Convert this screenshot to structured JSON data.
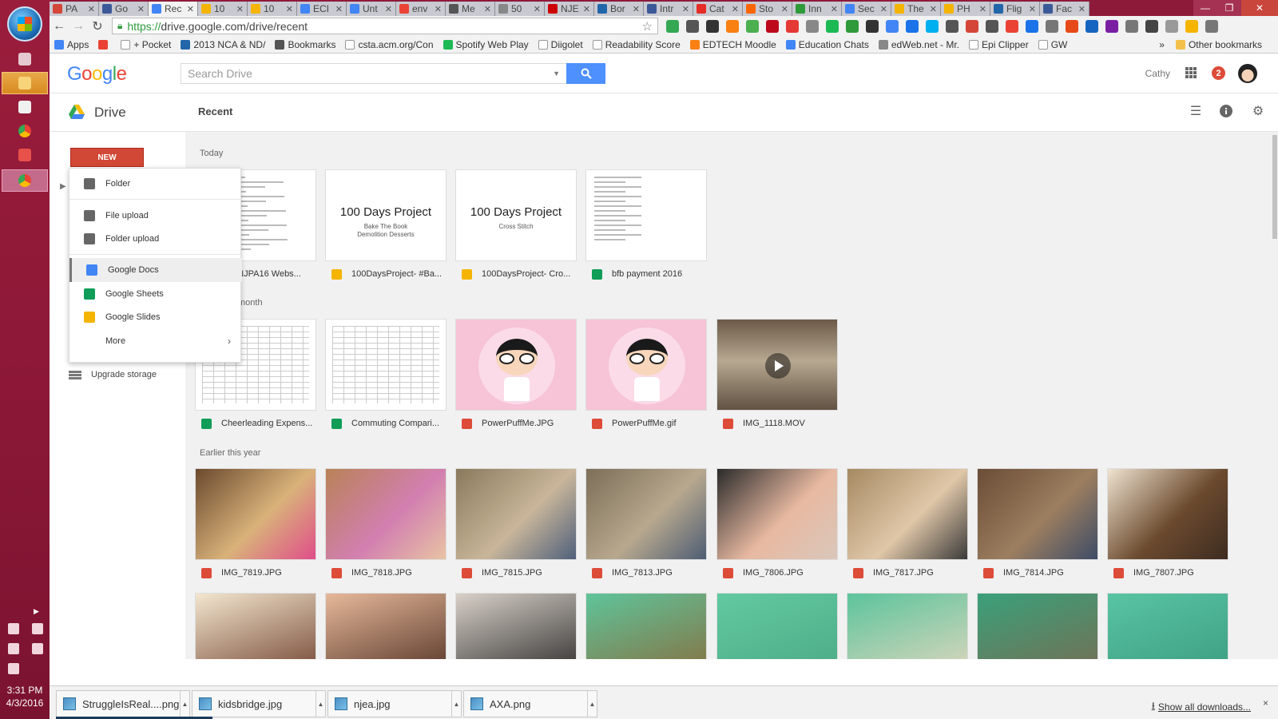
{
  "browser": {
    "tabs": [
      {
        "label": "PA",
        "color": "#d44638"
      },
      {
        "label": "Go",
        "color": "#3b5998"
      },
      {
        "label": "Rec",
        "color": "#4285f4",
        "active": true
      },
      {
        "label": "10",
        "color": "#f4b400"
      },
      {
        "label": "10",
        "color": "#f4b400"
      },
      {
        "label": "ECI",
        "color": "#4285f4"
      },
      {
        "label": "Unt",
        "color": "#4285f4"
      },
      {
        "label": "env",
        "color": "#ea4335"
      },
      {
        "label": "Me",
        "color": "#555555"
      },
      {
        "label": "50",
        "color": "#888888"
      },
      {
        "label": "NJE",
        "color": "#cc0000"
      },
      {
        "label": "Bor",
        "color": "#2266aa"
      },
      {
        "label": "Intr",
        "color": "#3b5998"
      },
      {
        "label": "Cat",
        "color": "#e52d27"
      },
      {
        "label": "Sto",
        "color": "#ff6600"
      },
      {
        "label": "Inn",
        "color": "#2e9a3a"
      },
      {
        "label": "Sec",
        "color": "#4285f4"
      },
      {
        "label": "The",
        "color": "#f4b400"
      },
      {
        "label": "PH",
        "color": "#f4b400"
      },
      {
        "label": "Flig",
        "color": "#2266aa"
      },
      {
        "label": "Fac",
        "color": "#3b5998"
      }
    ],
    "url_scheme": "https://",
    "url_rest": "drive.google.com/drive/recent",
    "bookmarks": [
      {
        "label": "Apps",
        "color": "#4285f4"
      },
      {
        "label": "",
        "color": "#ea4335"
      },
      {
        "label": "+ Pocket",
        "color": "#ffffff"
      },
      {
        "label": "2013 NCA & ND/",
        "color": "#2266aa"
      },
      {
        "label": "Bookmarks",
        "color": "#555555"
      },
      {
        "label": "csta.acm.org/Con",
        "color": "#ffffff"
      },
      {
        "label": "Spotify Web Play",
        "color": "#1db954"
      },
      {
        "label": "Diigolet",
        "color": "#ffffff"
      },
      {
        "label": "Readability Score",
        "color": "#ffffff"
      },
      {
        "label": "EDTECH Moodle",
        "color": "#f98012"
      },
      {
        "label": "Education Chats",
        "color": "#4285f4"
      },
      {
        "label": "edWeb.net - Mr.",
        "color": "#888888"
      },
      {
        "label": "Epi Clipper",
        "color": "#ffffff"
      },
      {
        "label": "GW",
        "color": "#ffffff"
      }
    ],
    "bookmarks_overflow": "»",
    "other_bookmarks": "Other bookmarks"
  },
  "header": {
    "logo": {
      "G": "G",
      "o1": "o",
      "o2": "o",
      "g": "g",
      "l": "l",
      "e": "e"
    },
    "search_placeholder": "Search Drive",
    "user_name": "Cathy",
    "notifications": "2"
  },
  "subheader": {
    "app_name": "Drive",
    "page_title": "Recent"
  },
  "leftnav": {
    "new_label": "NEW",
    "upgrade_label": "Upgrade storage"
  },
  "new_menu": {
    "items": [
      {
        "label": "Folder",
        "color": "#666666"
      },
      {
        "label": "File upload",
        "color": "#666666"
      },
      {
        "label": "Folder upload",
        "color": "#666666"
      },
      {
        "label": "Google Docs",
        "color": "#4285f4"
      },
      {
        "label": "Google Sheets",
        "color": "#0f9d58"
      },
      {
        "label": "Google Slides",
        "color": "#f4b400"
      },
      {
        "label": "More",
        "color": "#ffffff"
      }
    ],
    "more_arrow": "›"
  },
  "main": {
    "sections": [
      "Today",
      "month",
      "Earlier this year"
    ],
    "today": [
      {
        "name": "ET2NJPA16 Webs...",
        "type": "doc"
      },
      {
        "name": "100DaysProject- #Ba...",
        "type": "slides",
        "title": "100 Days Project",
        "sub1": "Bake The Book",
        "sub2": "Demolition Desserts"
      },
      {
        "name": "100DaysProject- Cro...",
        "type": "slides",
        "title": "100 Days Project",
        "sub1": "Cross Stitch",
        "sub2": ""
      },
      {
        "name": "bfb payment 2016",
        "type": "sheet"
      }
    ],
    "month": [
      {
        "name": "Cheerleading Expens...",
        "type": "sheet"
      },
      {
        "name": "Commuting Compari...",
        "type": "sheet"
      },
      {
        "name": "PowerPuffMe.JPG",
        "type": "image"
      },
      {
        "name": "PowerPuffMe.gif",
        "type": "image"
      },
      {
        "name": "IMG_1118.MOV",
        "type": "video"
      }
    ],
    "earlier": [
      {
        "name": "IMG_7819.JPG",
        "colors": [
          "#6b4a2e",
          "#d9b27a",
          "#e04a8a"
        ]
      },
      {
        "name": "IMG_7818.JPG",
        "colors": [
          "#b98257",
          "#d27fb0",
          "#e9c6a3"
        ]
      },
      {
        "name": "IMG_7815.JPG",
        "colors": [
          "#8a7a5c",
          "#c9b69a",
          "#4b5d7a"
        ]
      },
      {
        "name": "IMG_7813.JPG",
        "colors": [
          "#7d6f58",
          "#b7a88e",
          "#4a5a72"
        ]
      },
      {
        "name": "IMG_7806.JPG",
        "colors": [
          "#2a2a2a",
          "#e8b9a1",
          "#d9c7bb"
        ]
      },
      {
        "name": "IMG_7817.JPG",
        "colors": [
          "#a58a62",
          "#e0c7a8",
          "#353535"
        ]
      },
      {
        "name": "IMG_7814.JPG",
        "colors": [
          "#6b4c36",
          "#9c7e60",
          "#3a4a66"
        ]
      },
      {
        "name": "IMG_7807.JPG",
        "colors": [
          "#efe3d0",
          "#6b4a2e",
          "#3c2b20"
        ]
      }
    ],
    "more_row": [
      {
        "colors": [
          "#f3e6cf",
          "#6a3a26"
        ]
      },
      {
        "colors": [
          "#e6b89a",
          "#4a2b1e"
        ]
      },
      {
        "colors": [
          "#d8d0c8",
          "#222222"
        ]
      },
      {
        "colors": [
          "#5fc49a",
          "#8a6a3a"
        ]
      },
      {
        "colors": [
          "#62c9a0",
          "#4aa884"
        ]
      },
      {
        "colors": [
          "#5cc49c",
          "#e8d8c0"
        ]
      },
      {
        "colors": [
          "#3aa07a",
          "#7a6a50"
        ]
      },
      {
        "colors": [
          "#58c4a2",
          "#3b9a7e"
        ]
      }
    ]
  },
  "downloads": {
    "items": [
      "StruggleIsReal....png",
      "kidsbridge.jpg",
      "njea.jpg",
      "AXA.png"
    ],
    "show_all": "Show all downloads...",
    "close": "×"
  },
  "taskbar": {
    "time": "3:31 PM",
    "date": "4/3/2016"
  }
}
